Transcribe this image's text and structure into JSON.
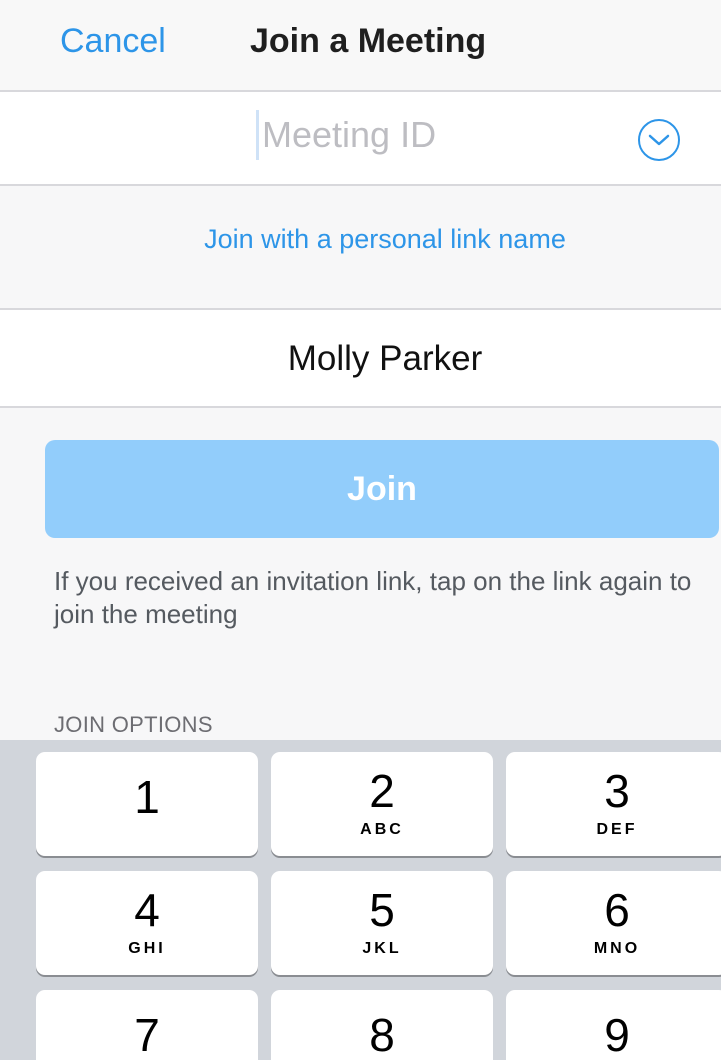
{
  "nav": {
    "cancel_label": "Cancel",
    "title": "Join a Meeting"
  },
  "meeting_id": {
    "placeholder": "Meeting ID",
    "value": ""
  },
  "personal_link": {
    "label": "Join with a personal link name"
  },
  "name_field": {
    "value": "Molly Parker"
  },
  "join_button": {
    "label": "Join"
  },
  "hint": "If you received an invitation link, tap on the link again to join the meeting",
  "options_label": "JOIN OPTIONS",
  "keypad": {
    "keys": [
      {
        "digit": "1",
        "letters": ""
      },
      {
        "digit": "2",
        "letters": "ABC"
      },
      {
        "digit": "3",
        "letters": "DEF"
      },
      {
        "digit": "4",
        "letters": "GHI"
      },
      {
        "digit": "5",
        "letters": "JKL"
      },
      {
        "digit": "6",
        "letters": "MNO"
      },
      {
        "digit": "7",
        "letters": ""
      },
      {
        "digit": "8",
        "letters": ""
      },
      {
        "digit": "9",
        "letters": ""
      }
    ]
  },
  "colors": {
    "accent": "#2d95e8",
    "join_button_disabled": "#92cdfb",
    "keyboard_background": "#d1d5db"
  },
  "icons": {
    "dropdown": "chevron-down-circle-icon"
  }
}
